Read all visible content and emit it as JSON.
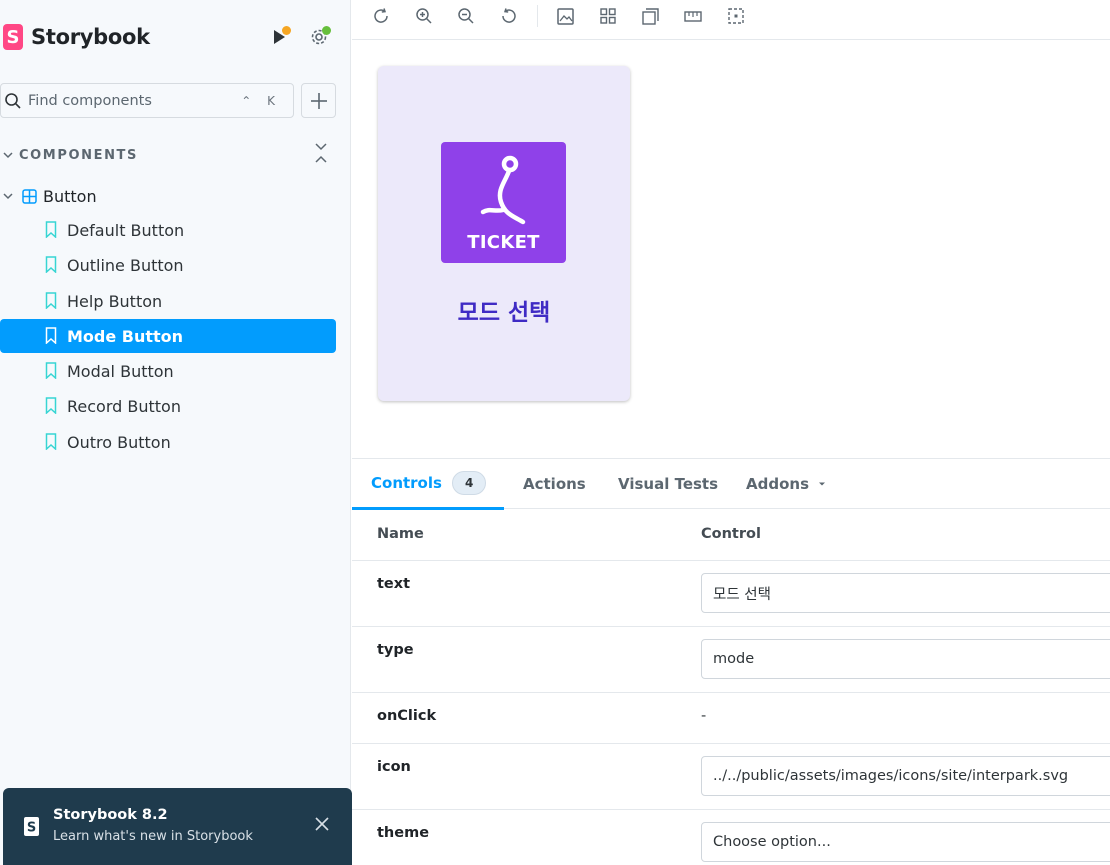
{
  "sidebar": {
    "brand": "Storybook",
    "brand_logo_letter": "S",
    "search_placeholder": "Find components",
    "search_shortcut": "⌃ K",
    "section_label": "COMPONENTS",
    "group_label": "Button",
    "stories": [
      {
        "label": "Default Button"
      },
      {
        "label": "Outline Button"
      },
      {
        "label": "Help Button"
      },
      {
        "label": "Mode Button",
        "active": true
      },
      {
        "label": "Modal Button"
      },
      {
        "label": "Record Button"
      },
      {
        "label": "Outro Button"
      }
    ]
  },
  "toast": {
    "title": "Storybook 8.2",
    "subtitle": "Learn what's new in Storybook"
  },
  "toolbar": {
    "icons": [
      "reload-icon",
      "zoom-in-icon",
      "zoom-out-icon",
      "reset-zoom-icon",
      "background-image-icon",
      "grid-icon",
      "viewport-icon",
      "measure-icon",
      "outline-icon"
    ]
  },
  "preview": {
    "icon_label": "TICKET",
    "text": "모드 선택",
    "card_bg": "#ece9fa",
    "icon_bg": "#8f41e9",
    "text_color": "#3f2bc4"
  },
  "panel": {
    "tabs": [
      {
        "label": "Controls",
        "badge": "4"
      },
      {
        "label": "Actions"
      },
      {
        "label": "Visual Tests"
      },
      {
        "label": "Addons"
      }
    ],
    "columns": {
      "name": "Name",
      "control": "Control"
    },
    "rows": [
      {
        "name": "text",
        "value": "모드 선택"
      },
      {
        "name": "type",
        "value": "mode"
      },
      {
        "name": "onClick",
        "value": "-"
      },
      {
        "name": "icon",
        "value": "../../public/assets/images/icons/site/interpark.svg"
      },
      {
        "name": "theme",
        "value": "Choose option..."
      }
    ]
  },
  "colors": {
    "accent": "#029cfd",
    "brand": "#ff4785",
    "toast_bg": "#1f3b4d"
  }
}
